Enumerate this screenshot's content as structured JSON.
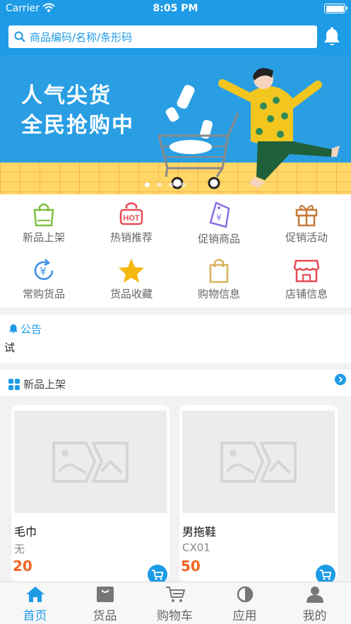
{
  "status_bar": {
    "carrier": "Carrier",
    "time": "8:05 PM"
  },
  "search": {
    "placeholder": "商品编码/名称/条形码"
  },
  "banner": {
    "line1": "人气尖货",
    "line2": "全民抢购中",
    "slide_count": 4,
    "active_slide": 1
  },
  "menu": [
    {
      "label": "新品上架",
      "icon": "shopping-bag-icon",
      "color": "#7cc142"
    },
    {
      "label": "热销推荐",
      "icon": "hot-tag-icon",
      "color": "#e84c57"
    },
    {
      "label": "促销商品",
      "icon": "price-tag-icon",
      "color": "#8c6fe2"
    },
    {
      "label": "促销活动",
      "icon": "gift-icon",
      "color": "#c57a3a"
    },
    {
      "label": "常购货品",
      "icon": "yen-refresh-icon",
      "color": "#3a8ee6"
    },
    {
      "label": "货品收藏",
      "icon": "star-icon",
      "color": "#f5b80f"
    },
    {
      "label": "购物信息",
      "icon": "shopping-bag-icon",
      "color": "#d8b25c"
    },
    {
      "label": "店铺信息",
      "icon": "store-icon",
      "color": "#e84c57"
    }
  ],
  "notice": {
    "title": "公告",
    "text": "试"
  },
  "new_arrivals": {
    "title": "新品上架"
  },
  "products": [
    {
      "name": "毛巾",
      "code": "无",
      "price": "20"
    },
    {
      "name": "男拖鞋",
      "code": "CX01",
      "price": "50"
    }
  ],
  "tabs": [
    {
      "label": "首页",
      "icon": "home-icon",
      "active": true
    },
    {
      "label": "货品",
      "icon": "goods-icon",
      "active": false
    },
    {
      "label": "购物车",
      "icon": "cart-icon",
      "active": false
    },
    {
      "label": "应用",
      "icon": "apps-icon",
      "active": false
    },
    {
      "label": "我的",
      "icon": "user-icon",
      "active": false
    }
  ],
  "colors": {
    "primary": "#1e9be6",
    "price": "#f26522",
    "banner_floor": "#ffd766"
  }
}
